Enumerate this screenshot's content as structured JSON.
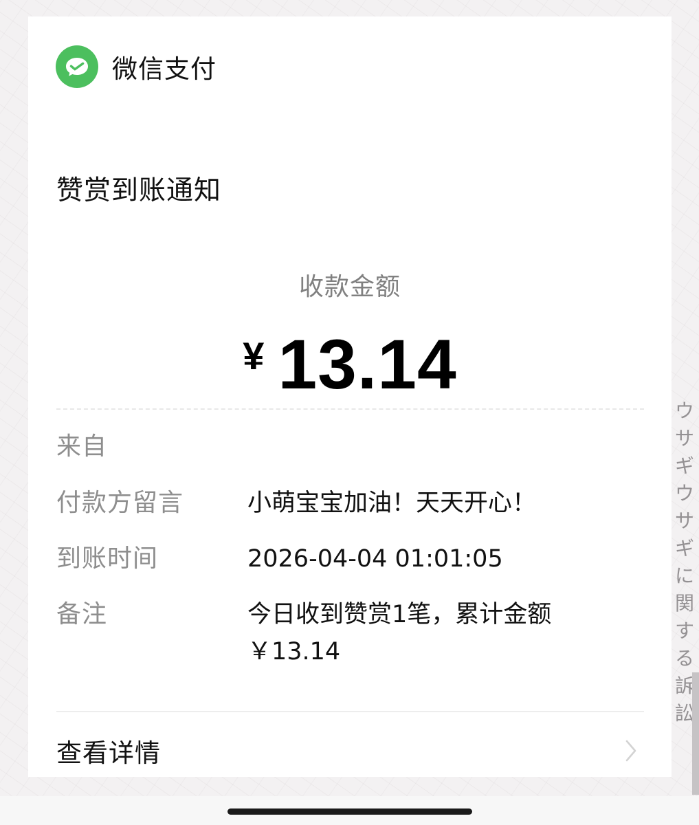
{
  "brand": {
    "name": "微信支付",
    "icon": "wechat-pay-logo",
    "color": "#4CBF5E"
  },
  "title": "赞赏到账通知",
  "amount": {
    "label": "收款金额",
    "currency": "¥",
    "value": "13.14"
  },
  "details": [
    {
      "label": "来自",
      "value": ""
    },
    {
      "label": "付款方留言",
      "value": "小萌宝宝加油！天天开心！"
    },
    {
      "label": "到账时间",
      "value": "2026-04-04 01:01:05"
    },
    {
      "label": "备注",
      "value_lines": [
        "今日收到赞赏1笔，累计金额",
        "￥13.14"
      ]
    }
  ],
  "detail_link": {
    "label": "查看详情",
    "icon": "chevron-right-icon"
  },
  "background_text": "ウサギウサギに関する訴訟"
}
